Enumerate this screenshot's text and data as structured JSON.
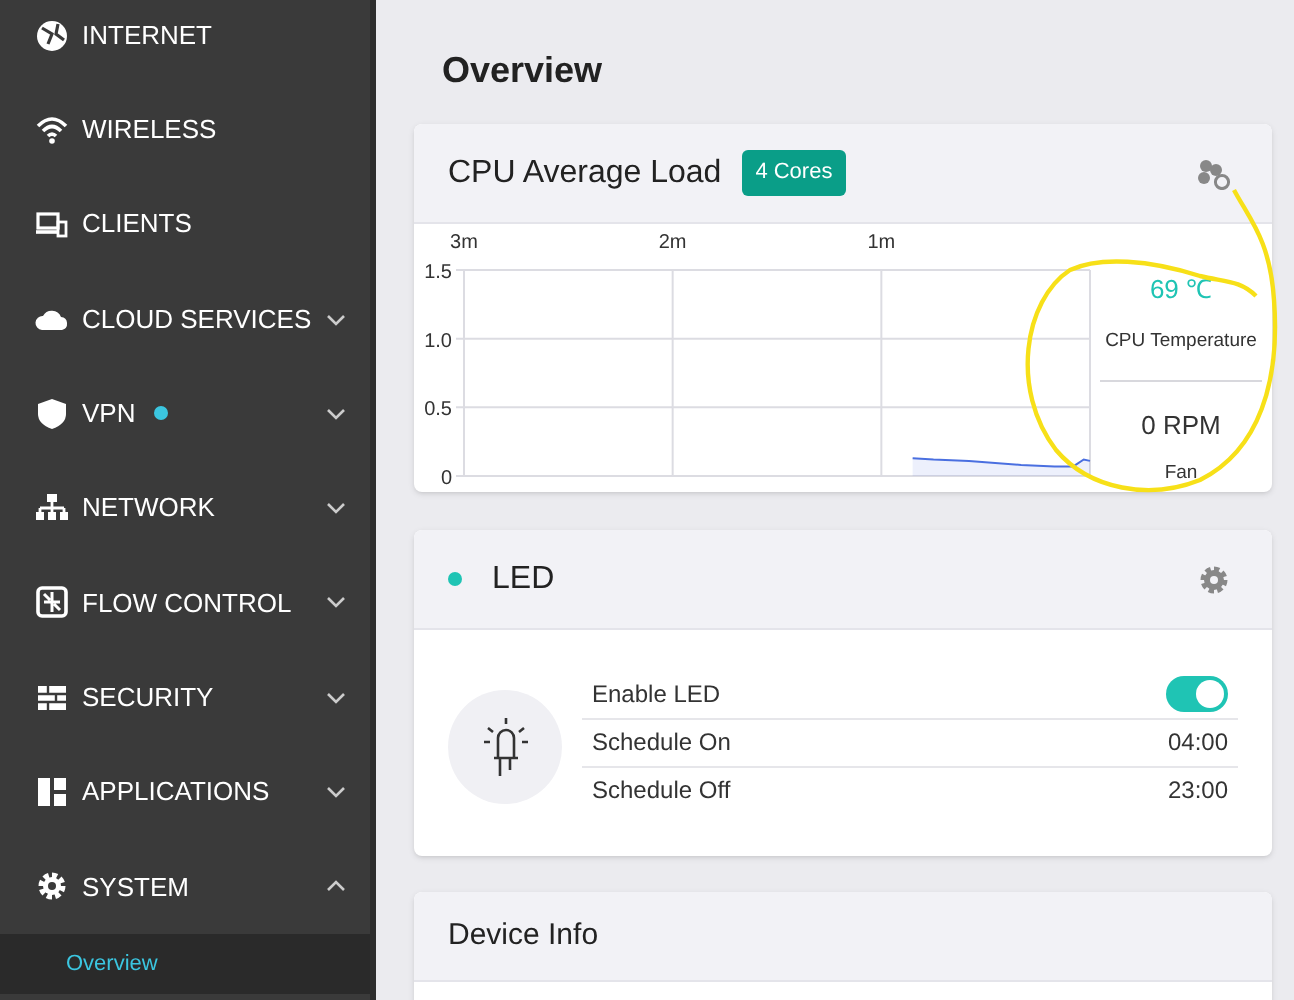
{
  "sidebar": {
    "items": [
      {
        "label": "INTERNET"
      },
      {
        "label": "WIRELESS"
      },
      {
        "label": "CLIENTS"
      },
      {
        "label": "CLOUD SERVICES",
        "expanded": false
      },
      {
        "label": "VPN",
        "expanded": false,
        "indicator": true
      },
      {
        "label": "NETWORK",
        "expanded": false
      },
      {
        "label": "FLOW CONTROL",
        "expanded": false
      },
      {
        "label": "SECURITY",
        "expanded": false
      },
      {
        "label": "APPLICATIONS",
        "expanded": false
      },
      {
        "label": "SYSTEM",
        "expanded": true,
        "children": [
          {
            "label": "Overview",
            "selected": true
          }
        ]
      }
    ]
  },
  "page_title": "Overview",
  "cpu_card": {
    "title": "CPU Average Load",
    "badge": "4 Cores",
    "chart_data": {
      "type": "area",
      "x": [
        0.85,
        0.75,
        0.58,
        0.33,
        0.17,
        0.08,
        0.03,
        0
      ],
      "series": [
        {
          "color": "#4a6fe0",
          "values": [
            0.13,
            0.12,
            0.11,
            0.08,
            0.07,
            0.07,
            0.12,
            0.11
          ]
        }
      ],
      "xlim": [
        3,
        0
      ],
      "ylim": [
        0,
        1.5
      ],
      "grid": true,
      "xticks": [
        {
          "value": 3,
          "label": "3m"
        },
        {
          "value": 2,
          "label": "2m"
        },
        {
          "value": 1,
          "label": "1m"
        }
      ],
      "yticks": [
        {
          "value": 1.5,
          "label": "1.5"
        },
        {
          "value": 1,
          "label": "1.0"
        },
        {
          "value": 0.5,
          "label": "0.5"
        },
        {
          "value": 0,
          "label": "0"
        }
      ]
    },
    "temperature": "69 ℃",
    "temperature_label": "CPU Temperature",
    "fan": "0 RPM",
    "fan_label": "Fan"
  },
  "led_card": {
    "title": "LED",
    "status_on": true,
    "rows": [
      {
        "label": "Enable LED",
        "kind": "toggle",
        "on": true
      },
      {
        "label": "Schedule On",
        "kind": "value",
        "value": "04:00"
      },
      {
        "label": "Schedule Off",
        "kind": "value",
        "value": "23:00"
      }
    ]
  },
  "device_card": {
    "title": "Device Info"
  }
}
